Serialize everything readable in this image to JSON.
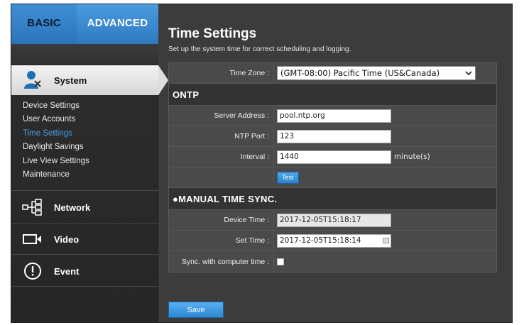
{
  "tabs": {
    "basic": "BASIC",
    "advanced": "ADVANCED"
  },
  "sidebar": {
    "system_label": "System",
    "items": [
      "Device Settings",
      "User Accounts",
      "Time Settings",
      "Daylight Savings",
      "Live View Settings",
      "Maintenance"
    ],
    "active_item": "Time Settings",
    "network_label": "Network",
    "video_label": "Video",
    "event_label": "Event"
  },
  "page": {
    "title": "Time Settings",
    "subtitle": "Set up the system time for correct scheduling and logging."
  },
  "form": {
    "time_zone_label": "Time Zone :",
    "time_zone_value": "(GMT-08:00) Pacific Time (US&Canada)",
    "ntp_header": "ONTP",
    "server_address_label": "Server Address :",
    "server_address_value": "pool.ntp.org",
    "ntp_port_label": "NTP Port :",
    "ntp_port_value": "123",
    "interval_label": "Interval :",
    "interval_value": "1440",
    "interval_unit": "minute(s)",
    "test_button": "Test",
    "manual_header": "●MANUAL TIME SYNC.",
    "device_time_label": "Device Time :",
    "device_time_value": "2017-12-05T15:18:17",
    "set_time_label": "Set Time :",
    "set_time_value": "2017-12-05T15:18:14",
    "sync_label": "Sync. with computer time :",
    "sync_checked": false
  },
  "save_button": "Save",
  "colors": {
    "accent": "#2e79c0",
    "active_link": "#4aa0e6",
    "background": "#3c3c3c"
  }
}
